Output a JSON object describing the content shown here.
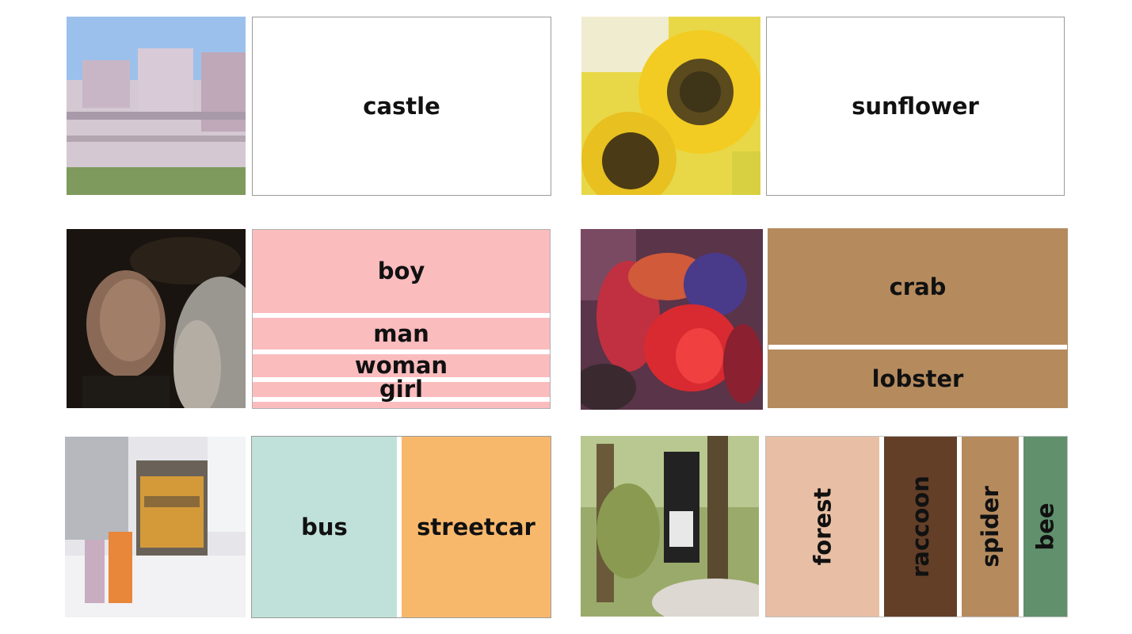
{
  "panels": [
    {
      "image_icon": "castle-photo",
      "labels": [
        {
          "text": "castle",
          "score": 1.0,
          "color": "#b4c8a8"
        }
      ]
    },
    {
      "image_icon": "sunflower-photo",
      "labels": [
        {
          "text": "sunflower",
          "score": 1.0,
          "color": "#a29b86"
        }
      ]
    },
    {
      "image_icon": "person-photo",
      "labels": [
        {
          "text": "boy",
          "score": 0.49,
          "color": "#fbbcbe"
        },
        {
          "text": "man",
          "score": 0.21,
          "color": "#fbbcbe"
        },
        {
          "text": "woman",
          "score": 0.15,
          "color": "#fbbcbe"
        },
        {
          "text": "girl",
          "score": 0.1,
          "color": "#fbbcbe"
        },
        {
          "text": "",
          "score": 0.05,
          "color": "#fbbcbe"
        }
      ]
    },
    {
      "image_icon": "crab-photo",
      "labels": [
        {
          "text": "crab",
          "score": 0.66,
          "color": "#b58b5e"
        },
        {
          "text": "lobster",
          "score": 0.34,
          "color": "#b58b5e"
        }
      ]
    },
    {
      "image_icon": "streetcar-photo",
      "labels": [
        {
          "text": "bus",
          "score": 0.5,
          "color": "#c0e1da"
        },
        {
          "text": "streetcar",
          "score": 0.5,
          "color": "#f8b86c"
        }
      ]
    },
    {
      "image_icon": "forest-photo",
      "labels": [
        {
          "text": "forest",
          "score": 0.39,
          "color": "#e8bfa4"
        },
        {
          "text": "raccoon",
          "score": 0.25,
          "color": "#633f28"
        },
        {
          "text": "spider",
          "score": 0.2,
          "color": "#b58b5e"
        },
        {
          "text": "bee",
          "score": 0.16,
          "color": "#60906c"
        }
      ]
    }
  ]
}
